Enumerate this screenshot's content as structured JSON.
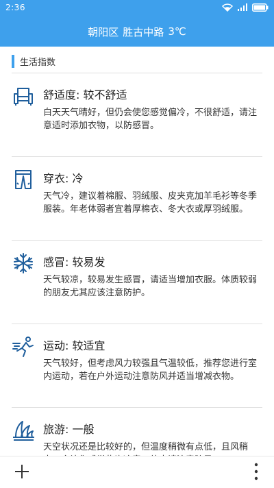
{
  "status_bar": {
    "time": "2:36",
    "icons": [
      "wifi-icon",
      "signal-icon",
      "battery-icon"
    ]
  },
  "header": {
    "district": "朝阳区",
    "road": "胜古中路",
    "temperature": "3℃"
  },
  "section": {
    "title": "生活指数"
  },
  "items": [
    {
      "icon": "armchair-icon",
      "title": "舒适度: 较不舒适",
      "desc": "白天天气晴好，但仍会使您感觉偏冷，不很舒适，请注意适时添加衣物，以防感冒。"
    },
    {
      "icon": "pants-icon",
      "title": "穿衣: 冷",
      "desc": "天气冷，建议着棉服、羽绒服、皮夹克加羊毛衫等冬季服装。年老体弱者宜着厚棉衣、冬大衣或厚羽绒服。"
    },
    {
      "icon": "snowflake-icon",
      "title": "感冒: 较易发",
      "desc": "天气较凉，较易发生感冒，请适当增加衣服。体质较弱的朋友尤其应该注意防护。"
    },
    {
      "icon": "runner-icon",
      "title": "运动: 较适宜",
      "desc": "天气较好，但考虑风力较强且气温较低，推荐您进行室内运动，若在户外运动注意防风并适当增减衣物。"
    },
    {
      "icon": "opera-house-icon",
      "title": "旅游: 一般",
      "desc": "天空状况还是比较好的，但温度稍微有点低，且风稍大，会让您感觉些许凉意。外出请注意防风。"
    }
  ],
  "colors": {
    "accent": "#3ea0ec",
    "icon": "#1f5e9c",
    "divider": "#e0e0e0"
  }
}
